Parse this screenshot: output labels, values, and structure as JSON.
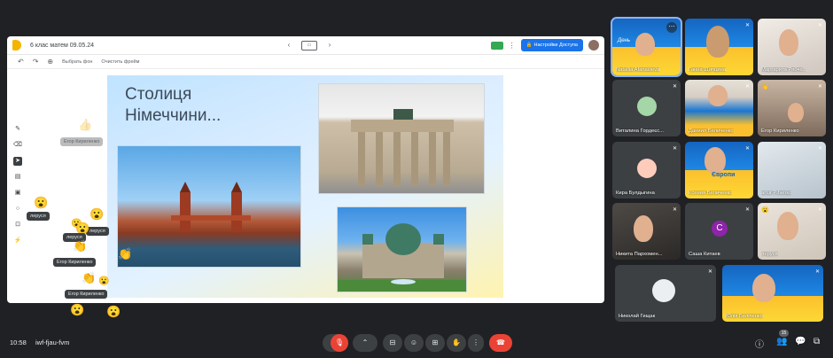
{
  "board": {
    "title": "6 клас матем 09.05.24",
    "access_button": "Настройки Доступа",
    "toolbar": {
      "background_label": "Выбрать фон",
      "clear_label": "Очистить фрейм"
    },
    "slide": {
      "title": "Столиця Німеччини..."
    }
  },
  "reactions": {
    "labels": [
      "Егор Кириленко",
      "леруся",
      "леруся",
      "леруся",
      "Егор Кириленко",
      "Егор Кириленко"
    ]
  },
  "participants": [
    {
      "name": "Natallia Afanasieva"
    },
    {
      "name": "Ганна Щипцина"
    },
    {
      "name": "Маргарита Рябче..."
    },
    {
      "name": "Виталина Гордеєс..."
    },
    {
      "name": "Даниил Беличенко"
    },
    {
      "name": "Егор Кириленко"
    },
    {
      "name": "Кира Булдыгина"
    },
    {
      "name": "Ксения Беличенко"
    },
    {
      "name": "artur Pihenko"
    },
    {
      "name": "Никита Пархомен..."
    },
    {
      "name": "Саша Китаев",
      "avatar_letter": "С"
    },
    {
      "name": "леруся"
    },
    {
      "name": "Николай Гищак"
    },
    {
      "name": "Юлія Беліченко"
    }
  ],
  "overlay_texts": {
    "banner_1": "День",
    "banner_2": "Європи"
  },
  "bottom": {
    "time": "10:58",
    "meeting_code": "iwf-fjau-fvm",
    "participants_count": "15"
  },
  "colors": {
    "background": "#202124",
    "accent_blue": "#1a73e8",
    "end_call_red": "#ea4335",
    "avatar_purple": "#8e24aa"
  }
}
